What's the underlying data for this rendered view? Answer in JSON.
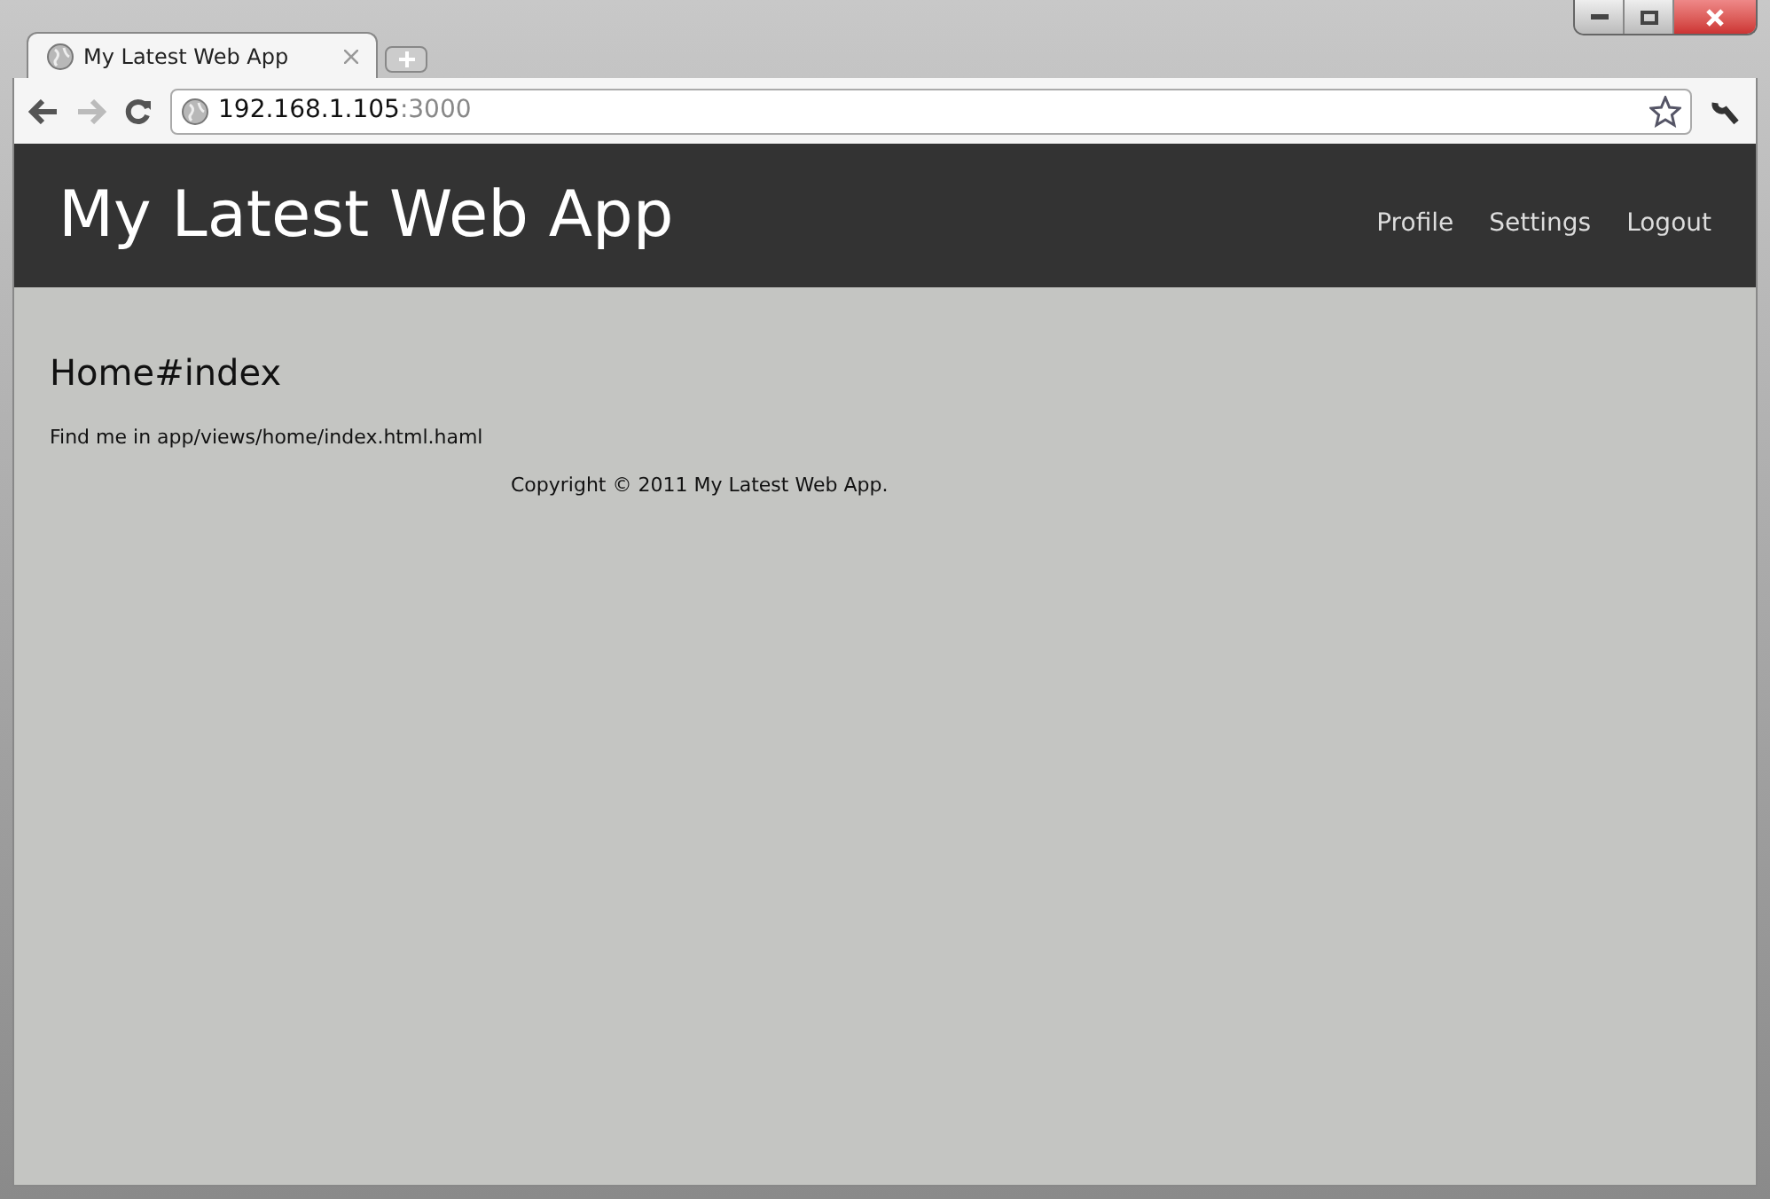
{
  "browser": {
    "tab": {
      "title": "My Latest Web App",
      "selected": true
    },
    "back_disabled": false,
    "forward_disabled": true,
    "address": {
      "host": "192.168.1.105",
      "port": ":3000"
    }
  },
  "header": {
    "title": "My Latest Web App",
    "nav": [
      "Profile",
      "Settings",
      "Logout"
    ]
  },
  "content": {
    "heading": "Home#index",
    "text": "Find me in app/views/home/index.html.haml",
    "footer": "Copyright © 2011 My Latest Web App."
  }
}
